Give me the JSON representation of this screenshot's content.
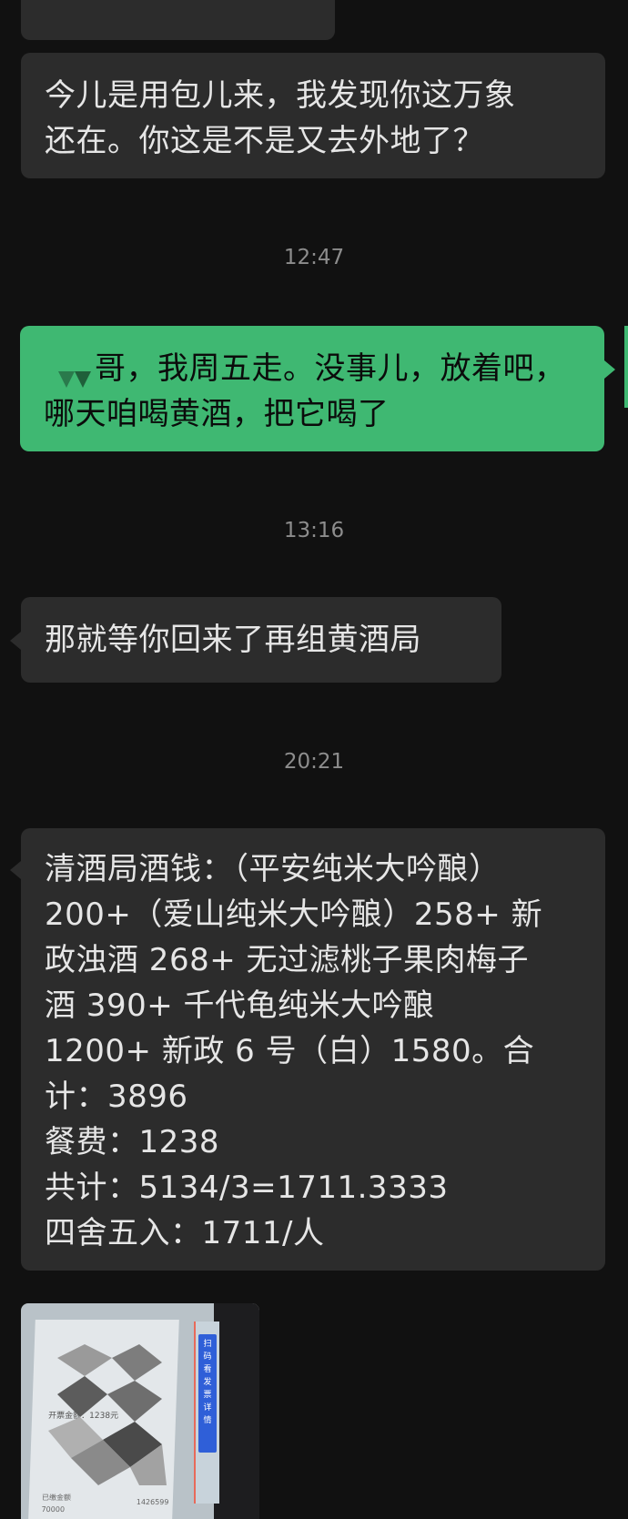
{
  "messages": [
    {
      "side": "in",
      "lines": [
        "今儿是用包儿来，我发现你这万象",
        "还在。你这是不是又去外地了？"
      ]
    },
    {
      "time": "12:47"
    },
    {
      "side": "out",
      "lines": [
        "哥，我周五走。没事儿，放着吧，",
        "哪天咱喝黄酒，把它喝了"
      ]
    },
    {
      "time": "13:16"
    },
    {
      "side": "in",
      "lines": [
        "那就等你回来了再组黄酒局"
      ]
    },
    {
      "time": "20:21"
    },
    {
      "side": "in",
      "lines": [
        "清酒局酒钱：（平安纯米大吟酿）",
        "200+（爱山纯米大吟酿）258+ 新",
        "政浊酒 268+ 无过滤桃子果肉梅子",
        "酒 390+ 千代龟纯米大吟酿",
        "1200+ 新政 6 号（白）1580。合",
        "计：3896",
        "餐费：1238",
        "共计：5134/3=1711.3333",
        "四舍五入：1711/人"
      ]
    }
  ],
  "image_message": {
    "receipt_text": "开票金额：1238元",
    "footer_left": "已缴金额",
    "footer_left_value": "70000",
    "footer_right_value": "1426599",
    "side_chars": [
      "扫",
      "码",
      "看",
      "发",
      "票",
      "详",
      "情"
    ]
  },
  "colors": {
    "background": "#111111",
    "incoming_bubble": "#2c2c2c",
    "outgoing_bubble": "#3fb872",
    "timestamp": "#8d8d8d"
  }
}
